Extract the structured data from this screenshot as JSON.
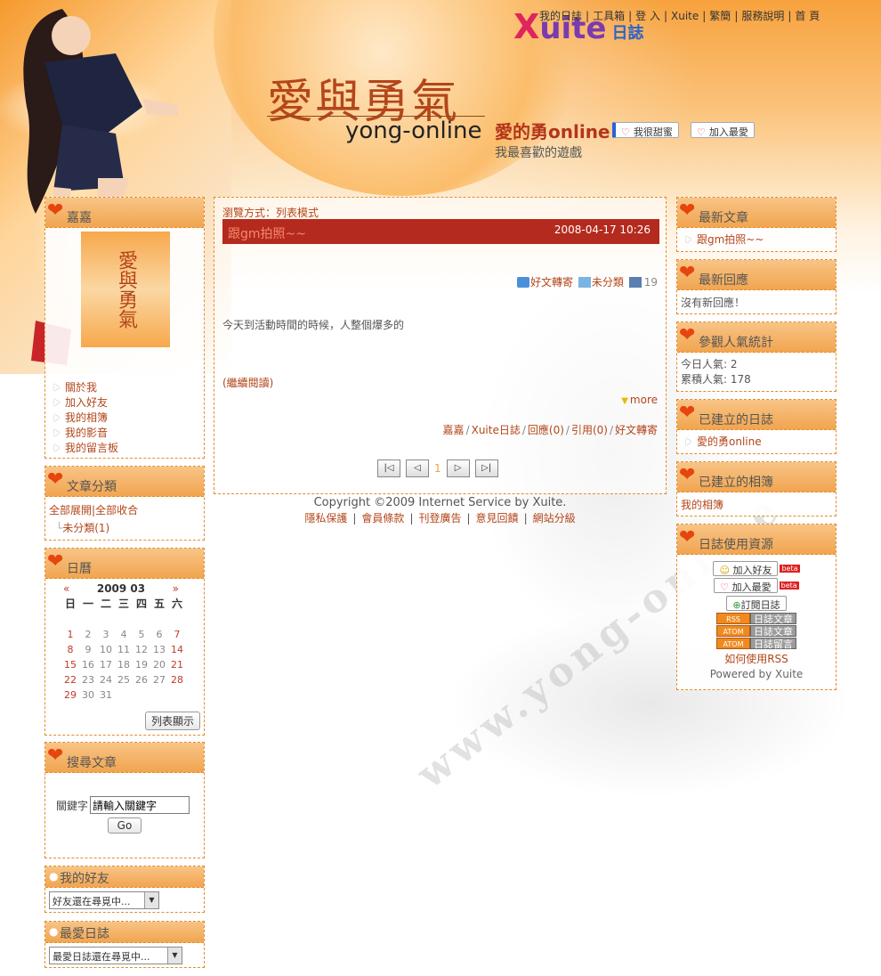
{
  "top_nav": {
    "items": [
      "我的日誌",
      "工具箱",
      "登 入",
      "Xuite",
      "繁簡",
      "服務說明",
      "首 頁"
    ],
    "separator": "|"
  },
  "logo": {
    "x": "X",
    "uite": "uite",
    "rizhi": "日誌"
  },
  "header": {
    "art_title": "愛與勇氣",
    "english_title": "yong-online",
    "blog_title": "愛的勇online",
    "blog_subtitle": "我最喜歡的遊戲",
    "sweet_button": "我很甜蜜",
    "fav_button": "加入最愛"
  },
  "left": {
    "profile": {
      "title": "嘉嘉",
      "avatar_text": "愛與勇氣",
      "links": [
        "關於我",
        "加入好友",
        "我的相簿",
        "我的影音",
        "我的留言板"
      ]
    },
    "categories": {
      "title": "文章分類",
      "expand_all": "全部展開",
      "collapse_all": "全部收合",
      "sep": "|",
      "items": [
        "未分類(1)"
      ]
    },
    "calendar": {
      "title": "日曆",
      "prev": "«",
      "next": "»",
      "month": "2009 03",
      "weekdays": [
        "日",
        "一",
        "二",
        "三",
        "四",
        "五",
        "六"
      ],
      "list_button": "列表顯示"
    },
    "search": {
      "title": "搜尋文章",
      "label": "關鍵字",
      "value": "請輸入關鍵字",
      "go_button": "Go"
    },
    "friends": {
      "title": "我的好友",
      "select_value": "好友還在尋覓中..."
    },
    "fav_blogs": {
      "title": "最愛日誌",
      "select_value": "最愛日誌還在尋覓中..."
    }
  },
  "center": {
    "browse_mode": "瀏覽方式：列表模式",
    "post": {
      "title": "跟gm拍照~~",
      "date": "2008-04-17 10:26",
      "share": "好文轉寄",
      "category": "未分類",
      "views": "19",
      "excerpt": "今天到活動時間的時候，人整個爆多的",
      "continue": "(繼續閱讀)",
      "more": "more",
      "footer": [
        "嘉嘉",
        "Xuite日誌",
        "回應(0)",
        "引用(0)",
        "好文轉寄"
      ]
    },
    "pager": {
      "first": "|◁",
      "prev": "◁",
      "current": "1",
      "next": "▷",
      "last": "▷|"
    }
  },
  "footer": {
    "copyright": "Copyright ©2009 Internet Service by Xuite.",
    "links": [
      "隱私保護",
      "會員條款",
      "刊登廣告",
      "意見回饋",
      "網站分級"
    ]
  },
  "right": {
    "latest": {
      "title": "最新文章",
      "items": [
        "跟gm拍照~~"
      ]
    },
    "replies": {
      "title": "最新回應",
      "empty": "沒有新回應！"
    },
    "stats": {
      "title": "參觀人氣統計",
      "today": "今日人氣: 2",
      "total": "累積人氣: 178"
    },
    "blogs": {
      "title": "已建立的日誌",
      "items": [
        "愛的勇online"
      ]
    },
    "albums": {
      "title": "已建立的相簿",
      "items": [
        "我的相簿"
      ]
    },
    "resources": {
      "title": "日誌使用資源",
      "add_friend": "加入好友",
      "add_fav": "加入最愛",
      "beta": "beta",
      "subscribe": "訂閱日誌",
      "rss_tag": "RSS",
      "atom_tag": "ATOM",
      "rss_posts": "日誌文章",
      "atom_posts": "日誌文章",
      "atom_comments": "日誌留言",
      "how_rss": "如何使用RSS",
      "powered": "Powered by Xuite"
    }
  },
  "watermark": "www.yong-online",
  "colors": {
    "accent": "#b3461a",
    "title_bar": "#b52a1e",
    "box_border": "#e38b2c"
  }
}
